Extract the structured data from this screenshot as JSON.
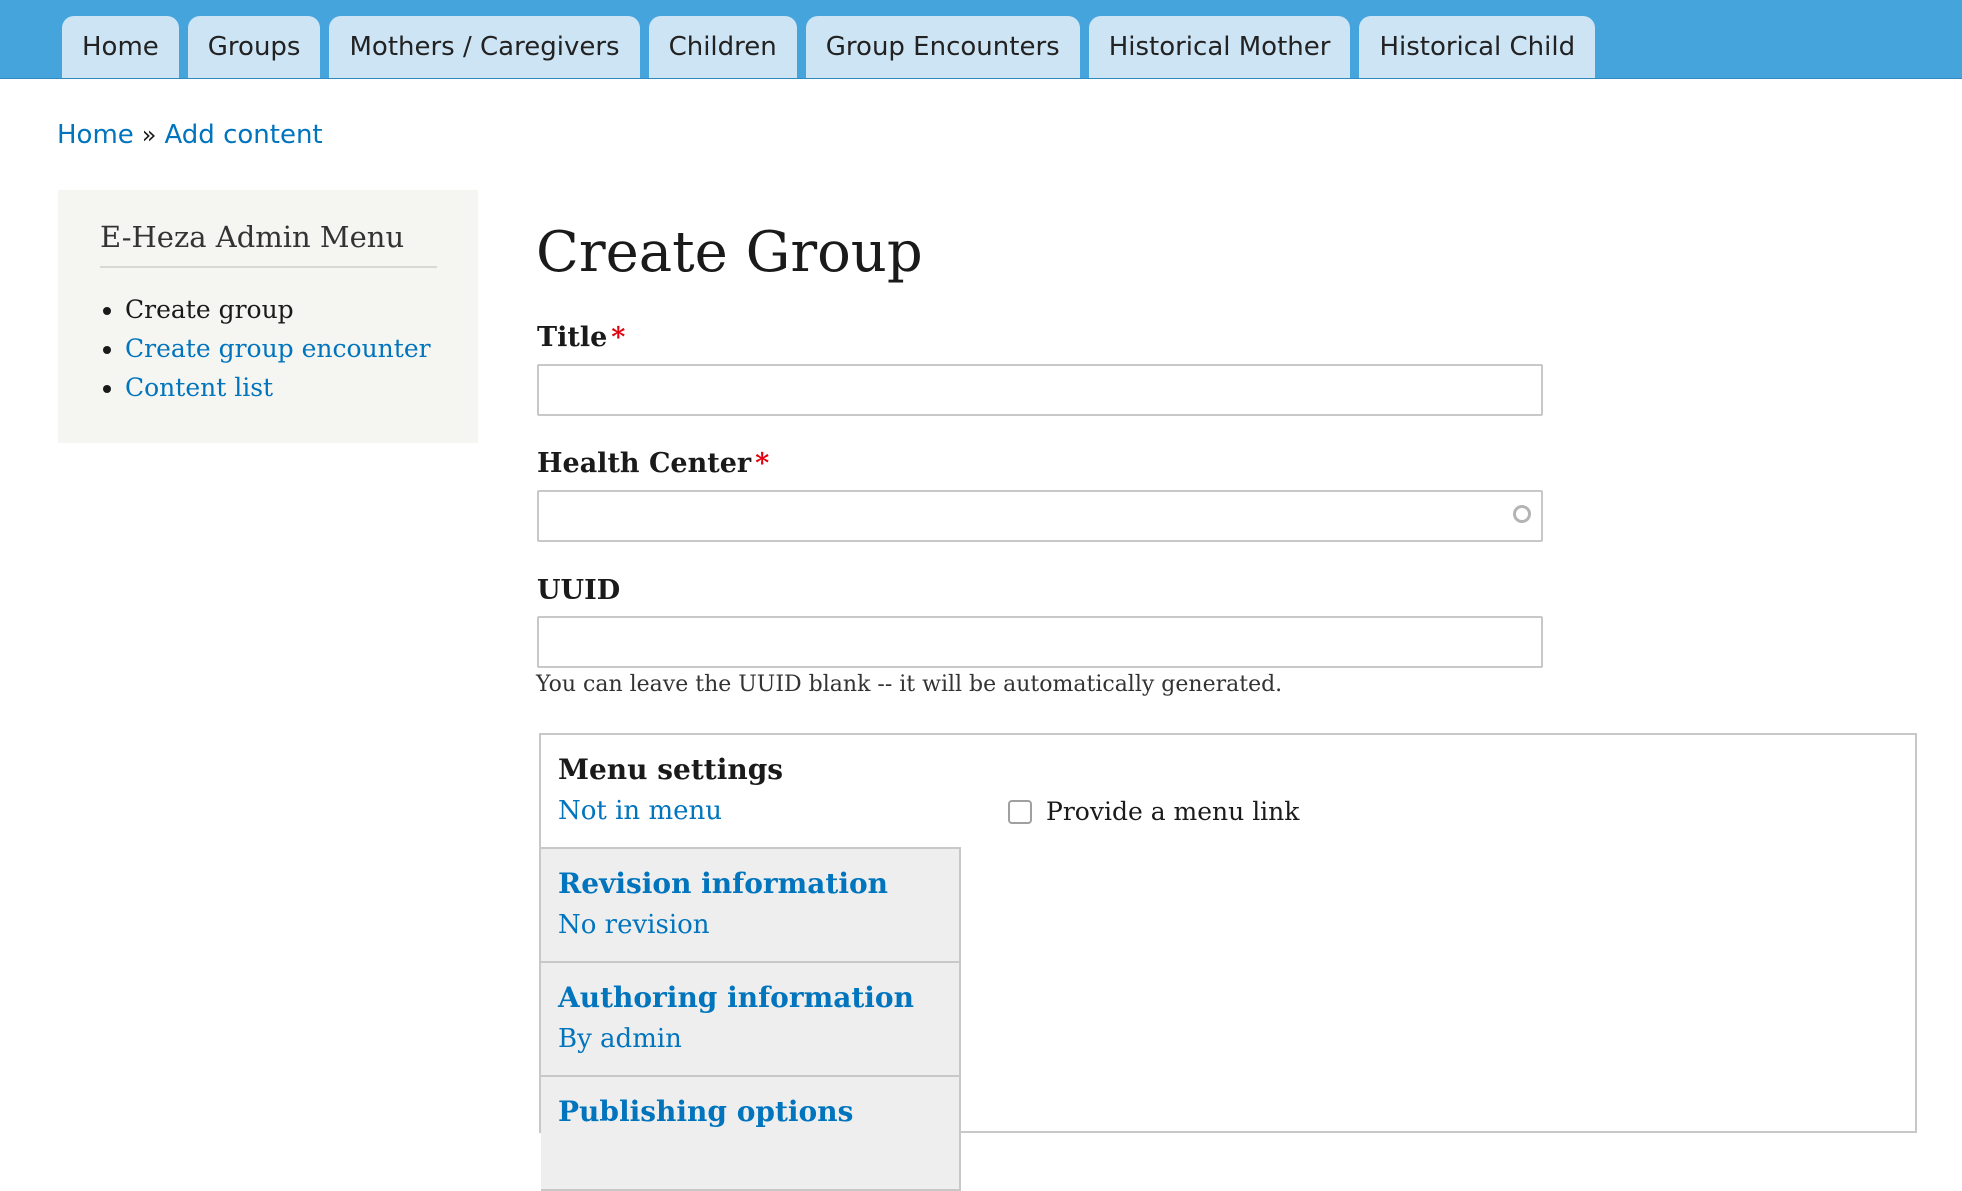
{
  "nav": {
    "tabs": [
      "Home",
      "Groups",
      "Mothers / Caregivers",
      "Children",
      "Group Encounters",
      "Historical Mother",
      "Historical Child"
    ]
  },
  "breadcrumb": {
    "home": "Home",
    "separator": "»",
    "current": "Add content"
  },
  "sidebar": {
    "title": "E-Heza Admin Menu",
    "items": [
      {
        "label": "Create group",
        "active": true
      },
      {
        "label": "Create group encounter",
        "active": false
      },
      {
        "label": "Content list",
        "active": false
      }
    ]
  },
  "form": {
    "page_title": "Create Group",
    "title": {
      "label": "Title",
      "required_mark": "*",
      "value": ""
    },
    "health_center": {
      "label": "Health Center",
      "required_mark": "*",
      "value": ""
    },
    "uuid": {
      "label": "UUID",
      "value": "",
      "description": "You can leave the UUID blank -- it will be automatically generated."
    }
  },
  "vertical_tabs": {
    "tabs": [
      {
        "title": "Menu settings",
        "summary": "Not in menu"
      },
      {
        "title": "Revision information",
        "summary": "No revision"
      },
      {
        "title": "Authoring information",
        "summary": "By admin"
      },
      {
        "title": "Publishing options",
        "summary": ""
      }
    ],
    "menu_settings": {
      "checkbox_label": "Provide a menu link",
      "checked": false
    }
  },
  "colors": {
    "nav_bar": "#45a4dc",
    "tab_bg": "#cde4f5",
    "link": "#0074bd",
    "required": "#e3000f"
  }
}
